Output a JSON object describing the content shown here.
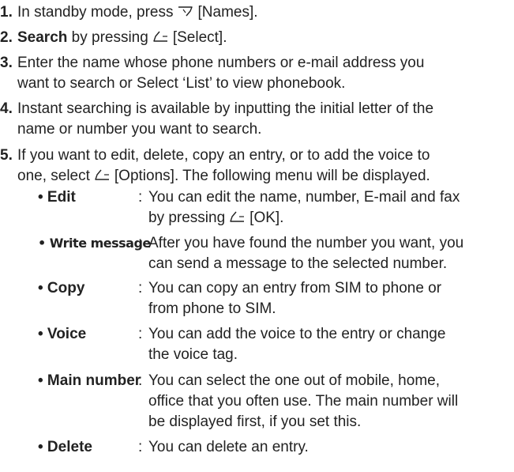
{
  "steps": [
    {
      "num": "1.",
      "text_a": "In standby mode, press",
      "icon": "right-softkey-icon",
      "text_b": "[Names]."
    },
    {
      "num": "2.",
      "bold": "Search",
      "text_a": "by pressing",
      "icon": "left-softkey-icon",
      "text_b": "[Select]."
    },
    {
      "num": "3.",
      "line1": "Enter the name whose phone numbers or e-mail address you",
      "line2": "want to search or Select ‘List’ to view phonebook."
    },
    {
      "num": "4.",
      "line1": "Instant searching is available by inputting the initial letter of the",
      "line2": "name or number you want to search."
    },
    {
      "num": "5.",
      "line1": "If you want to edit, delete, copy an entry, or to add the voice to",
      "line2_a": "one, select",
      "icon": "left-softkey-icon",
      "line2_b": "[Options]. The following menu will be displayed."
    }
  ],
  "options": [
    {
      "name": "• Edit",
      "line1": "You can edit the name, number, E-mail and fax",
      "line2_a": "by pressing",
      "icon": "left-softkey-icon",
      "line2_b": "[OK]."
    },
    {
      "name": "• Write message",
      "line1": "After you have found the number you want, you",
      "line2": "can send a message to the selected number."
    },
    {
      "name": "• Copy",
      "line1": "You can copy an entry from SIM to phone or",
      "line2": "from phone to SIM."
    },
    {
      "name": "• Voice",
      "line1": "You can add the voice to the entry or change",
      "line2": "the voice tag."
    },
    {
      "name": "• Main number",
      "line1": "You can select the one out of mobile, home,",
      "line2": "office that you often use. The main number will",
      "line3": "be displayed first, if you set this."
    },
    {
      "name": "• Delete",
      "line1": "You can delete an entry."
    }
  ],
  "colon": ":"
}
